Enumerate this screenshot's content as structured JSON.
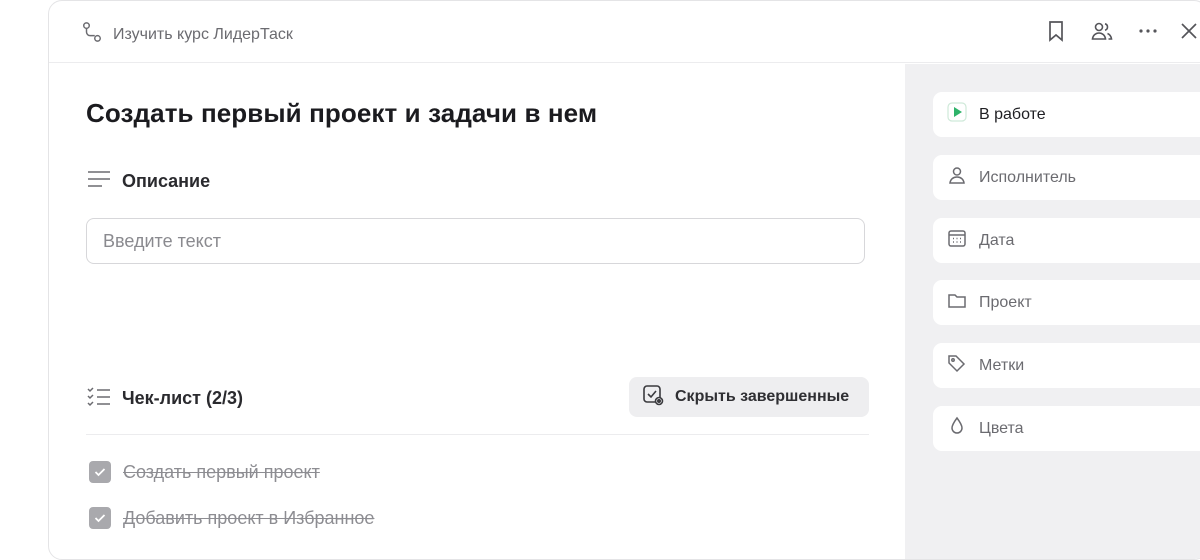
{
  "breadcrumb": {
    "label": "Изучить курс ЛидерТаск",
    "icon": "route-icon"
  },
  "top_actions": [
    {
      "name": "bookmark-icon"
    },
    {
      "name": "users-icon"
    },
    {
      "name": "more-icon"
    },
    {
      "name": "close-icon"
    }
  ],
  "task": {
    "title": "Создать первый проект и задачи в нем"
  },
  "description": {
    "heading": "Описание",
    "placeholder": "Введите текст"
  },
  "checklist": {
    "heading": "Чек-лист (2/3)",
    "hide_button": "Скрыть завершенные",
    "items": [
      {
        "label": "Создать первый проект",
        "checked": true
      },
      {
        "label": "Добавить проект в Избранное",
        "checked": true
      }
    ]
  },
  "sidebar": {
    "status": {
      "label": "В работе",
      "color": "#2fb36a"
    },
    "fields": [
      {
        "label": "Исполнитель",
        "icon": "person-icon"
      },
      {
        "label": "Дата",
        "icon": "calendar-icon"
      },
      {
        "label": "Проект",
        "icon": "folder-icon"
      },
      {
        "label": "Метки",
        "icon": "tag-icon"
      },
      {
        "label": "Цвета",
        "icon": "drop-icon"
      }
    ]
  }
}
